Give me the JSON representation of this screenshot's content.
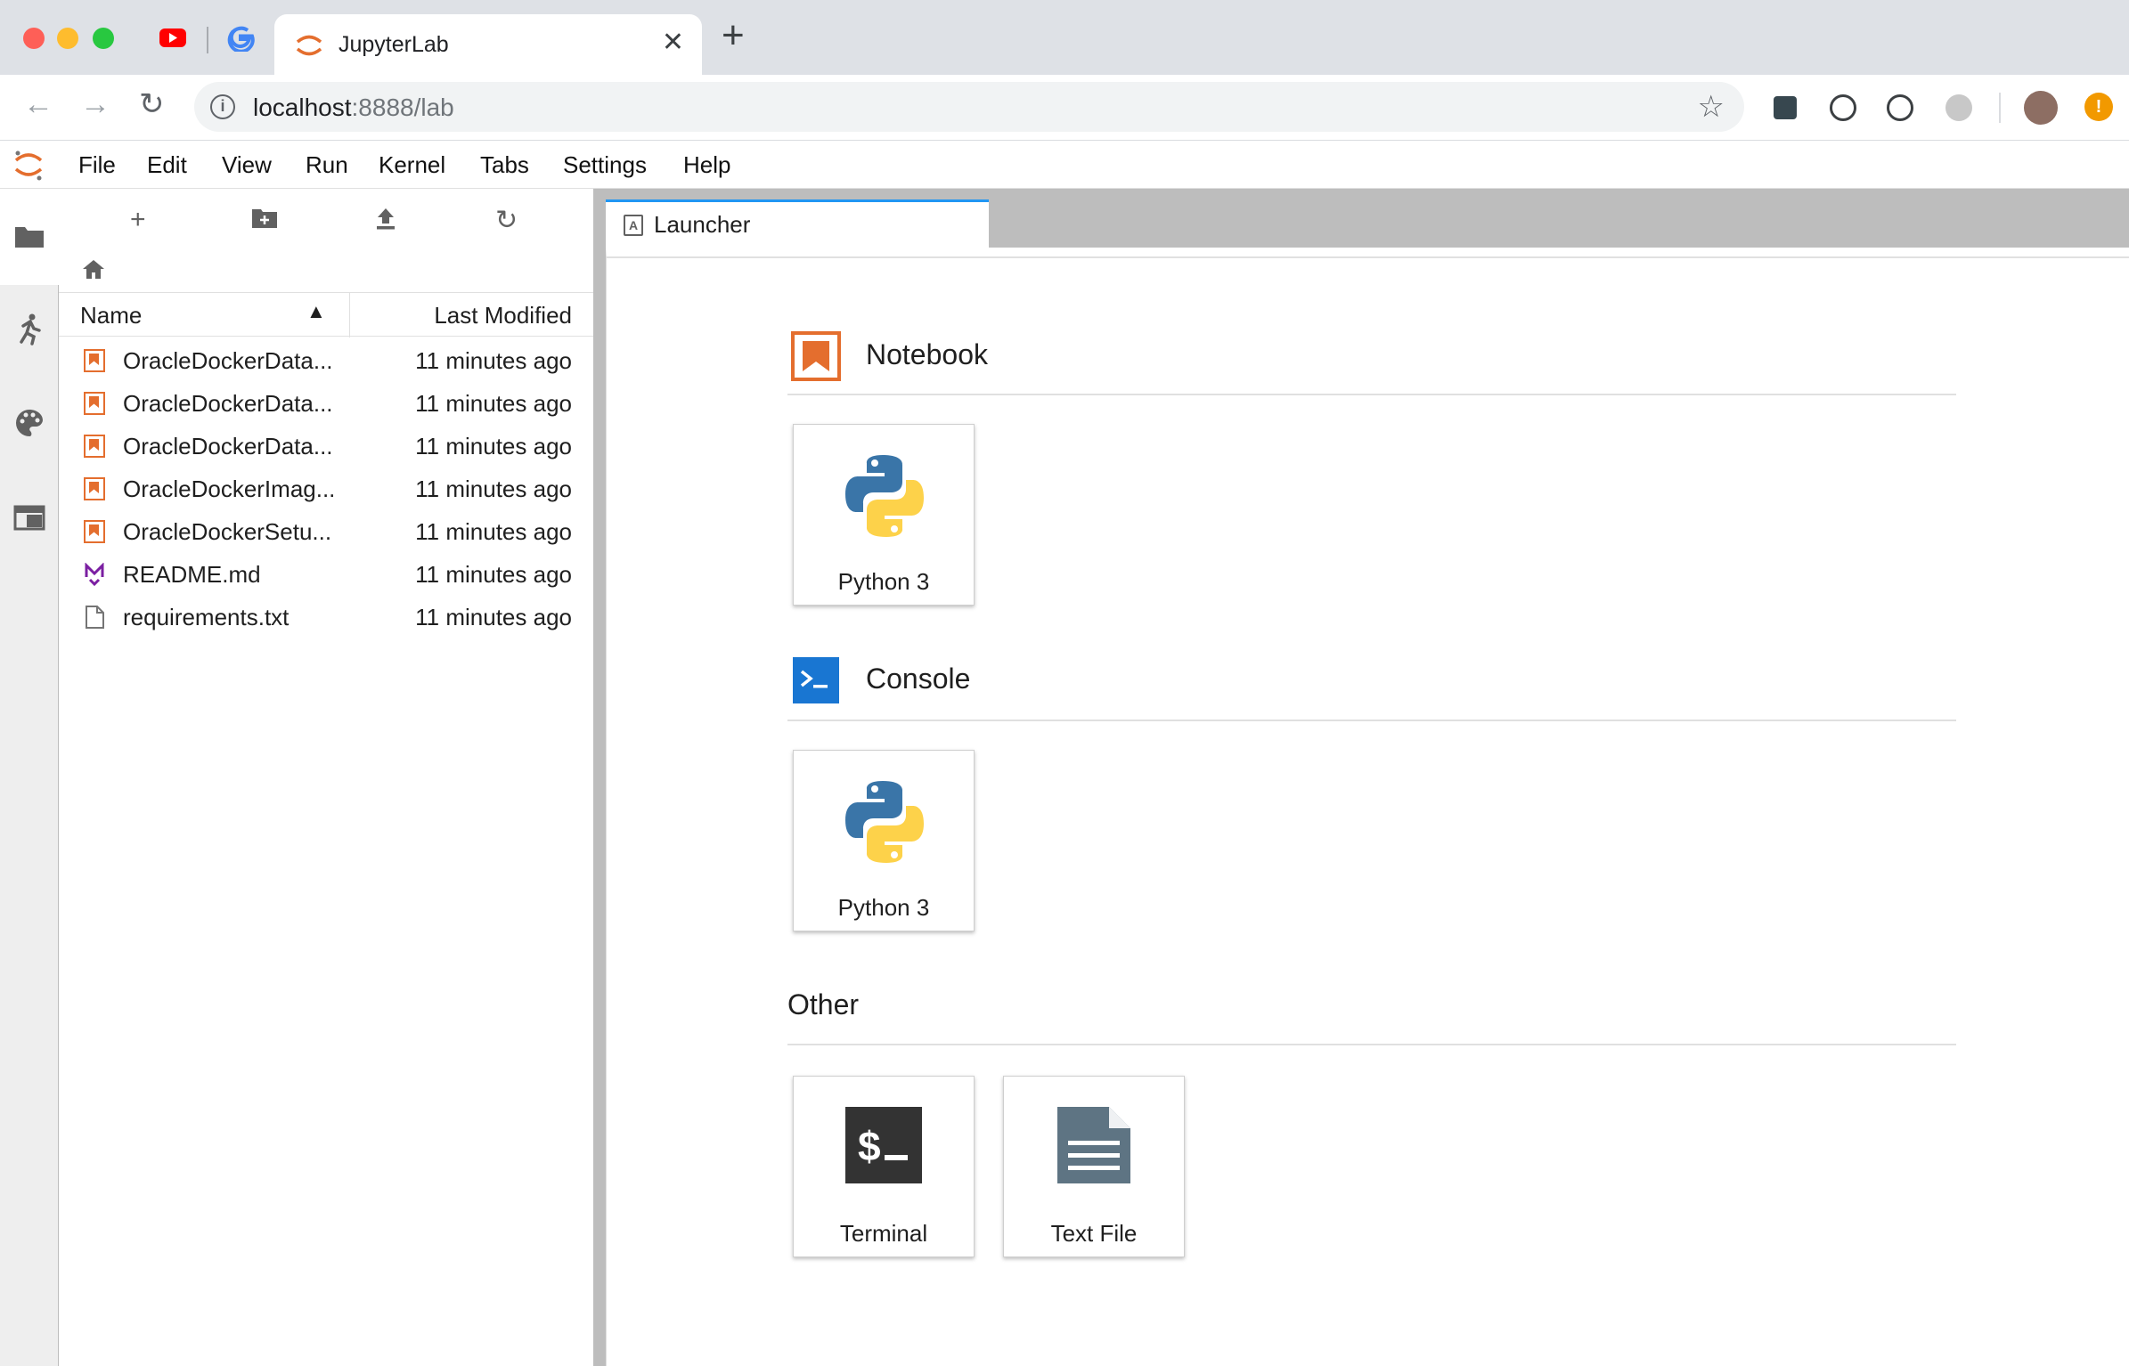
{
  "browser": {
    "tab_title": "JupyterLab",
    "url_host": "localhost",
    "url_rest": ":8888/lab"
  },
  "menubar": {
    "items": [
      "File",
      "Edit",
      "View",
      "Run",
      "Kernel",
      "Tabs",
      "Settings",
      "Help"
    ]
  },
  "filebrowser": {
    "header": {
      "name": "Name",
      "modified": "Last Modified"
    },
    "files": [
      {
        "name": "OracleDockerData...",
        "modified": "11 minutes ago",
        "type": "notebook"
      },
      {
        "name": "OracleDockerData...",
        "modified": "11 minutes ago",
        "type": "notebook"
      },
      {
        "name": "OracleDockerData...",
        "modified": "11 minutes ago",
        "type": "notebook"
      },
      {
        "name": "OracleDockerImag...",
        "modified": "11 minutes ago",
        "type": "notebook"
      },
      {
        "name": "OracleDockerSetu...",
        "modified": "11 minutes ago",
        "type": "notebook"
      },
      {
        "name": "README.md",
        "modified": "11 minutes ago",
        "type": "markdown"
      },
      {
        "name": "requirements.txt",
        "modified": "11 minutes ago",
        "type": "text"
      }
    ]
  },
  "main": {
    "tab_label": "Launcher",
    "sections": {
      "notebook": {
        "title": "Notebook",
        "cards": [
          "Python 3"
        ]
      },
      "console": {
        "title": "Console",
        "cards": [
          "Python 3"
        ]
      },
      "other": {
        "title": "Other",
        "cards": [
          "Terminal",
          "Text File"
        ]
      }
    }
  },
  "colors": {
    "jupyter_orange": "#e46e2e",
    "console_blue": "#1976d2",
    "active_tab_accent": "#2196f3"
  }
}
